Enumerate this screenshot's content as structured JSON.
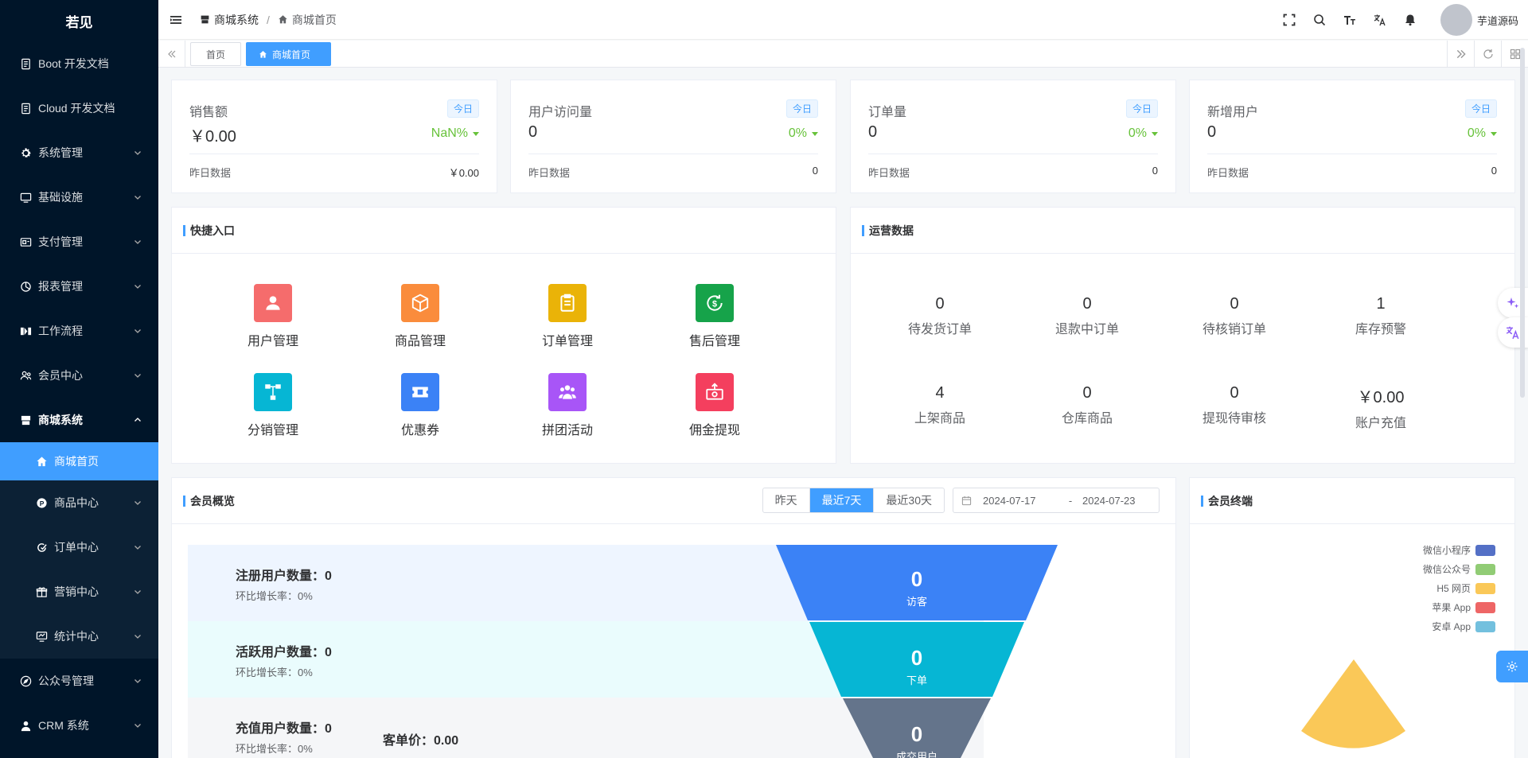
{
  "brand": "若见",
  "sidebar": {
    "items": [
      {
        "label": "Boot 开发文档",
        "icon": "document-icon"
      },
      {
        "label": "Cloud 开发文档",
        "icon": "document-icon"
      },
      {
        "label": "系统管理",
        "icon": "gear-icon"
      },
      {
        "label": "基础设施",
        "icon": "monitor-icon"
      },
      {
        "label": "支付管理",
        "icon": "payment-icon"
      },
      {
        "label": "报表管理",
        "icon": "pie-chart-icon"
      },
      {
        "label": "工作流程",
        "icon": "workflow-icon"
      },
      {
        "label": "会员中心",
        "icon": "member-icon"
      },
      {
        "label": "商城系统",
        "icon": "shop-icon"
      },
      {
        "label": "商城首页",
        "icon": "home-icon"
      },
      {
        "label": "商品中心",
        "icon": "product-icon"
      },
      {
        "label": "订单中心",
        "icon": "order-icon"
      },
      {
        "label": "营销中心",
        "icon": "gift-icon"
      },
      {
        "label": "统计中心",
        "icon": "stats-icon"
      },
      {
        "label": "公众号管理",
        "icon": "compass-icon"
      },
      {
        "label": "CRM 系统",
        "icon": "user-icon"
      }
    ]
  },
  "header": {
    "breadcrumb": [
      "商城系统",
      "商城首页"
    ],
    "username": "芋道源码"
  },
  "tags": [
    "首页",
    "商城首页"
  ],
  "stats": [
    {
      "title": "销售额",
      "badge": "今日",
      "value": "￥0.00",
      "trend": "NaN%",
      "foot_label": "昨日数据",
      "foot_value": "￥0.00"
    },
    {
      "title": "用户访问量",
      "badge": "今日",
      "value": "0",
      "trend": "0%",
      "foot_label": "昨日数据",
      "foot_value": "0"
    },
    {
      "title": "订单量",
      "badge": "今日",
      "value": "0",
      "trend": "0%",
      "foot_label": "昨日数据",
      "foot_value": "0"
    },
    {
      "title": "新增用户",
      "badge": "今日",
      "value": "0",
      "trend": "0%",
      "foot_label": "昨日数据",
      "foot_value": "0"
    }
  ],
  "quick": {
    "title": "快捷入口",
    "items": [
      {
        "label": "用户管理",
        "color": "#f56c6c"
      },
      {
        "label": "商品管理",
        "color": "#fa8c3c"
      },
      {
        "label": "订单管理",
        "color": "#eab308"
      },
      {
        "label": "售后管理",
        "color": "#16a34a"
      },
      {
        "label": "分销管理",
        "color": "#06b6d4"
      },
      {
        "label": "优惠券",
        "color": "#3b82f6"
      },
      {
        "label": "拼团活动",
        "color": "#a855f7"
      },
      {
        "label": "佣金提现",
        "color": "#f43f5e"
      }
    ]
  },
  "ops": {
    "title": "运营数据",
    "items": [
      {
        "value": "0",
        "label": "待发货订单"
      },
      {
        "value": "0",
        "label": "退款中订单"
      },
      {
        "value": "0",
        "label": "待核销订单"
      },
      {
        "value": "1",
        "label": "库存预警"
      },
      {
        "value": "4",
        "label": "上架商品"
      },
      {
        "value": "0",
        "label": "仓库商品"
      },
      {
        "value": "0",
        "label": "提现待审核"
      },
      {
        "value": "￥0.00",
        "label": "账户充值"
      }
    ]
  },
  "member": {
    "title": "会员概览",
    "ranges": [
      "昨天",
      "最近7天",
      "最近30天"
    ],
    "date_start": "2024-07-17",
    "date_sep": "-",
    "date_end": "2024-07-23",
    "rows": [
      {
        "title": "注册用户数量：0",
        "sub": "环比增长率：0%",
        "bg": "#eef5ff"
      },
      {
        "title": "活跃用户数量：0",
        "sub": "环比增长率：0%",
        "bg": "#eafcfd"
      },
      {
        "title": "充值用户数量：0",
        "sub": "环比增长率：0%",
        "bg": "#f5f6f8",
        "extra": "客单价：0.00"
      }
    ],
    "funnel": [
      {
        "value": "0",
        "label": "访客",
        "color": "#3b82f6"
      },
      {
        "value": "0",
        "label": "下单",
        "color": "#06b6d4"
      },
      {
        "value": "0",
        "label": "成交用户",
        "color": "#64748b"
      }
    ]
  },
  "terminal": {
    "title": "会员终端",
    "legend": [
      {
        "name": "微信小程序",
        "color": "#5470c6"
      },
      {
        "name": "微信公众号",
        "color": "#91cc75"
      },
      {
        "name": "H5 网页",
        "color": "#fac858"
      },
      {
        "name": "苹果 App",
        "color": "#ee6666"
      },
      {
        "name": "安卓 App",
        "color": "#73c0de"
      }
    ]
  }
}
